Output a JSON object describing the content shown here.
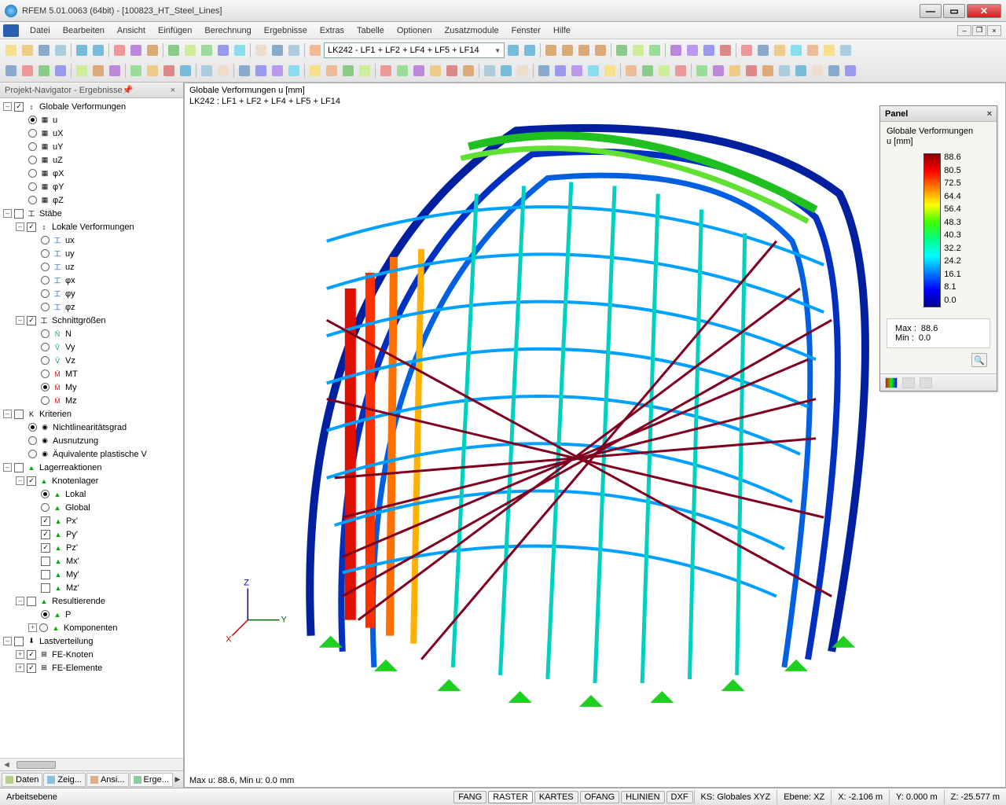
{
  "window": {
    "title": "RFEM 5.01.0063 (64bit) - [100823_HT_Steel_Lines]"
  },
  "menu": {
    "items": [
      "Datei",
      "Bearbeiten",
      "Ansicht",
      "Einfügen",
      "Berechnung",
      "Ergebnisse",
      "Extras",
      "Tabelle",
      "Optionen",
      "Zusatzmodule",
      "Fenster",
      "Hilfe"
    ]
  },
  "toolbar": {
    "load_combo": "LK242 - LF1 + LF2 + LF4 + LF5 + LF14"
  },
  "navigator": {
    "title": "Projekt-Navigator - Ergebnisse",
    "root": {
      "label": "Globale Verformungen",
      "checked": true
    },
    "glob_children": [
      {
        "label": "u",
        "radio": true,
        "on": true
      },
      {
        "label": "uX",
        "radio": true
      },
      {
        "label": "uY",
        "radio": true
      },
      {
        "label": "uZ",
        "radio": true
      },
      {
        "label": "φX",
        "radio": true
      },
      {
        "label": "φY",
        "radio": true
      },
      {
        "label": "φZ",
        "radio": true
      }
    ],
    "staebe": {
      "label": "Stäbe"
    },
    "lokale": {
      "label": "Lokale Verformungen",
      "checked": true
    },
    "lokale_children": [
      {
        "label": "ux"
      },
      {
        "label": "uy"
      },
      {
        "label": "uz"
      },
      {
        "label": "φx"
      },
      {
        "label": "φy"
      },
      {
        "label": "φz"
      }
    ],
    "schnitt": {
      "label": "Schnittgrößen",
      "checked": true
    },
    "schnitt_children": [
      {
        "label": "N"
      },
      {
        "label": "Vy"
      },
      {
        "label": "Vz"
      },
      {
        "label": "MT"
      },
      {
        "label": "My",
        "on": true
      },
      {
        "label": "Mz"
      }
    ],
    "kriterien": {
      "label": "Kriterien"
    },
    "kriterien_children": [
      {
        "label": "Nichtlinearitätsgrad",
        "on": true
      },
      {
        "label": "Ausnutzung"
      },
      {
        "label": "Äquivalente plastische V"
      }
    ],
    "lager": {
      "label": "Lagerreaktionen"
    },
    "knoten": {
      "label": "Knotenlager",
      "checked": true
    },
    "knoten_children": [
      {
        "label": "Lokal",
        "radio": true,
        "on": true
      },
      {
        "label": "Global",
        "radio": true
      },
      {
        "label": "Px'",
        "chk": true,
        "checked": true
      },
      {
        "label": "Py'",
        "chk": true,
        "checked": true
      },
      {
        "label": "Pz'",
        "chk": true,
        "checked": true
      },
      {
        "label": "Mx'",
        "chk": true
      },
      {
        "label": "My'",
        "chk": true
      },
      {
        "label": "Mz'",
        "chk": true
      }
    ],
    "result": {
      "label": "Resultierende"
    },
    "result_children": [
      {
        "label": "P",
        "radio": true,
        "on": true
      },
      {
        "label": "Komponenten",
        "exp": true
      }
    ],
    "lastv": {
      "label": "Lastverteilung"
    },
    "lastv_children": [
      {
        "label": "FE-Knoten",
        "checked": true,
        "exp": true
      },
      {
        "label": "FE-Elemente",
        "checked": true,
        "exp": true
      }
    ],
    "tabs": [
      {
        "label": "Daten",
        "icon": "#b8d088"
      },
      {
        "label": "Zeig...",
        "icon": "#88c0e0"
      },
      {
        "label": "Ansi...",
        "icon": "#e0b088"
      },
      {
        "label": "Erge...",
        "icon": "#88d0a0"
      }
    ]
  },
  "viewport": {
    "header_line1": "Globale Verformungen u [mm]",
    "header_line2": "LK242 : LF1 + LF2 + LF4 + LF5 + LF14",
    "footer": "Max u: 88.6, Min u: 0.0 mm"
  },
  "panel": {
    "title": "Panel",
    "caption_l1": "Globale Verformungen",
    "caption_l2": "u [mm]",
    "ticks": [
      "88.6",
      "80.5",
      "72.5",
      "64.4",
      "56.4",
      "48.3",
      "40.3",
      "32.2",
      "24.2",
      "16.1",
      "8.1",
      "0.0"
    ],
    "max_label": "Max  :",
    "max_val": "88.6",
    "min_label": "Min   :",
    "min_val": "0.0"
  },
  "status": {
    "left": "Arbeitsebene",
    "btns": [
      "FANG",
      "RASTER",
      "KARTES",
      "OFANG",
      "HLINIEN",
      "DXF"
    ],
    "active": "RASTER",
    "ks": "KS: Globales XYZ",
    "ebene": "Ebene: XZ",
    "x": "X: -2.106 m",
    "y": "Y: 0.000 m",
    "z": "Z: -25.577 m"
  },
  "chart_data": {
    "type": "colorbar",
    "title": "Globale Verformungen u [mm]",
    "min": 0.0,
    "max": 88.6,
    "ticks": [
      88.6,
      80.5,
      72.5,
      64.4,
      56.4,
      48.3,
      40.3,
      32.2,
      24.2,
      16.1,
      8.1,
      0.0
    ],
    "colormap": "rainbow (red=max → blue=min)"
  }
}
